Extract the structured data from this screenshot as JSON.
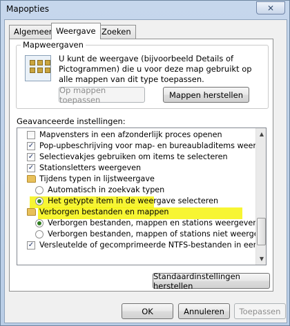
{
  "window": {
    "title": "Mapopties",
    "close_label": "✕"
  },
  "tabs": [
    {
      "label": "Algemeen",
      "active": false
    },
    {
      "label": "Weergave",
      "active": true
    },
    {
      "label": "Zoeken",
      "active": false
    }
  ],
  "folder_views": {
    "group_title": "Mapweergaven",
    "description": "U kunt de weergave (bijvoorbeeld Details of Pictogrammen) die u voor deze map gebruikt op alle mappen van dit type toepassen.",
    "apply_button": "Op mappen toepassen",
    "reset_button": "Mappen herstellen"
  },
  "advanced": {
    "label": "Geavanceerde instellingen:",
    "items": [
      {
        "type": "checkbox",
        "checked": false,
        "label": "Mapvensters in een afzonderlijk proces openen"
      },
      {
        "type": "checkbox",
        "checked": true,
        "label": "Pop-upbeschrijving voor map- en bureaubladitems weergeven"
      },
      {
        "type": "checkbox",
        "checked": true,
        "label": "Selectievakjes gebruiken om items te selecteren"
      },
      {
        "type": "checkbox",
        "checked": true,
        "label": "Stationsletters weergeven"
      },
      {
        "type": "folder",
        "label": "Tijdens typen in lijstweergave"
      },
      {
        "type": "radio",
        "checked": false,
        "label": "Automatisch in zoekvak typen"
      },
      {
        "type": "radio",
        "checked": true,
        "label": "Het getypte item in de weergave selecteren"
      },
      {
        "type": "folder",
        "label": "Verborgen bestanden en mappen",
        "highlight": true
      },
      {
        "type": "radio",
        "checked": true,
        "label": "Verborgen bestanden, mappen en stations weergeven",
        "highlight": true
      },
      {
        "type": "radio",
        "checked": false,
        "label": "Verborgen bestanden, mappen of stations niet weergeven"
      },
      {
        "type": "checkbox",
        "checked": true,
        "label": "Versleutelde of gecomprimeerde NTFS-bestanden in een andere"
      }
    ],
    "scroll_up": "▲",
    "scroll_down": "▼"
  },
  "restore_defaults_button": "Standaardinstellingen herstellen",
  "footer": {
    "ok": "OK",
    "cancel": "Annuleren",
    "apply": "Toepassen"
  }
}
